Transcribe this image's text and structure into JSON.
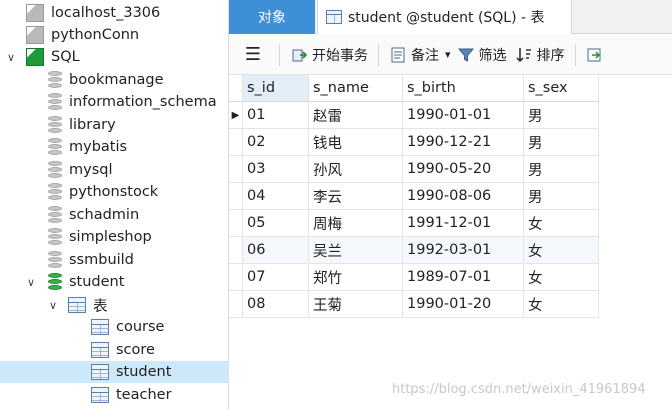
{
  "sidebar": {
    "items": [
      {
        "label": "localhost_3306",
        "icon": "connection-icon",
        "level": 0
      },
      {
        "label": "pythonConn",
        "icon": "connection-icon",
        "level": 0
      },
      {
        "label": "SQL",
        "icon": "connection-icon",
        "level": 0,
        "expanded": true
      },
      {
        "label": "bookmanage",
        "icon": "database-icon",
        "level": 1
      },
      {
        "label": "information_schema",
        "icon": "database-icon",
        "level": 1
      },
      {
        "label": "library",
        "icon": "database-icon",
        "level": 1
      },
      {
        "label": "mybatis",
        "icon": "database-icon",
        "level": 1
      },
      {
        "label": "mysql",
        "icon": "database-icon",
        "level": 1
      },
      {
        "label": "pythonstock",
        "icon": "database-icon",
        "level": 1
      },
      {
        "label": "schadmin",
        "icon": "database-icon",
        "level": 1
      },
      {
        "label": "simpleshop",
        "icon": "database-icon",
        "level": 1
      },
      {
        "label": "ssmbuild",
        "icon": "database-icon",
        "level": 1
      },
      {
        "label": "student",
        "icon": "database-icon",
        "level": 1,
        "expanded": true
      },
      {
        "label": "表",
        "icon": "tables-folder-icon",
        "level": 2,
        "expanded": true
      },
      {
        "label": "course",
        "icon": "table-icon",
        "level": 3
      },
      {
        "label": "score",
        "icon": "table-icon",
        "level": 3
      },
      {
        "label": "student",
        "icon": "table-icon",
        "level": 3,
        "selected": true
      },
      {
        "label": "teacher",
        "icon": "table-icon",
        "level": 3
      }
    ]
  },
  "tabs": {
    "objects_label": "对象",
    "active_label": "student @student (SQL) - 表"
  },
  "toolbar": {
    "menu_icon": "hamburger-icon",
    "begin_transaction": "开始事务",
    "memo": "备注",
    "memo_dropdown": "▾",
    "filter": "筛选",
    "sort": "排序"
  },
  "grid": {
    "columns": [
      "s_id",
      "s_name",
      "s_birth",
      "s_sex"
    ],
    "rows": [
      [
        "01",
        "赵雷",
        "1990-01-01",
        "男"
      ],
      [
        "02",
        "钱电",
        "1990-12-21",
        "男"
      ],
      [
        "03",
        "孙风",
        "1990-05-20",
        "男"
      ],
      [
        "04",
        "李云",
        "1990-08-06",
        "男"
      ],
      [
        "05",
        "周梅",
        "1991-12-01",
        "女"
      ],
      [
        "06",
        "吴兰",
        "1992-03-01",
        "女"
      ],
      [
        "07",
        "郑竹",
        "1989-07-01",
        "女"
      ],
      [
        "08",
        "王菊",
        "1990-01-20",
        "女"
      ]
    ],
    "current_row_marker": "▶"
  },
  "watermark": "https://blog.csdn.net/weixin_41961894",
  "colors": {
    "accent": "#3d8fd6",
    "selection": "#cde8fb",
    "connection_active": "#1e9b3a"
  }
}
